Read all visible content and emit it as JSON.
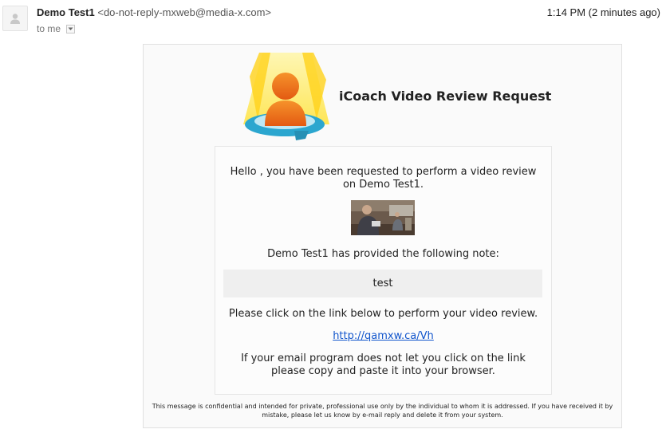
{
  "header": {
    "sender_name": "Demo Test1",
    "sender_email": "<do-not-reply-mxweb@media-x.com>",
    "recipient": "to me",
    "timestamp": "1:14 PM (2 minutes ago)"
  },
  "email": {
    "title": "iCoach Video Review Request",
    "greeting": "Hello , you have been requested to perform a video review on Demo Test1.",
    "note_intro": "Demo Test1 has provided the following note:",
    "note": "test",
    "instructions": "Please click on the link below to perform your video review.",
    "link": "http://qamxw.ca/Vh",
    "fallback": "If your email program does not let you click on the link please copy and paste it into your browser.",
    "disclaimer": "This message is confidential and intended for private, professional use only by the individual to whom it is addressed. If you have received it by mistake, please let us know by e-mail reply and delete it from your system."
  },
  "icons": {
    "avatar": "person-silhouette-icon",
    "details_toggle": "chevron-down-icon",
    "logo": "icoach-spotlight-person-logo",
    "thumbnail": "video-thumbnail"
  },
  "colors": {
    "link": "#1155cc",
    "logo_orange": "#f07a1a",
    "logo_yellow": "#ffe84a",
    "logo_blue": "#2ba6cf"
  }
}
